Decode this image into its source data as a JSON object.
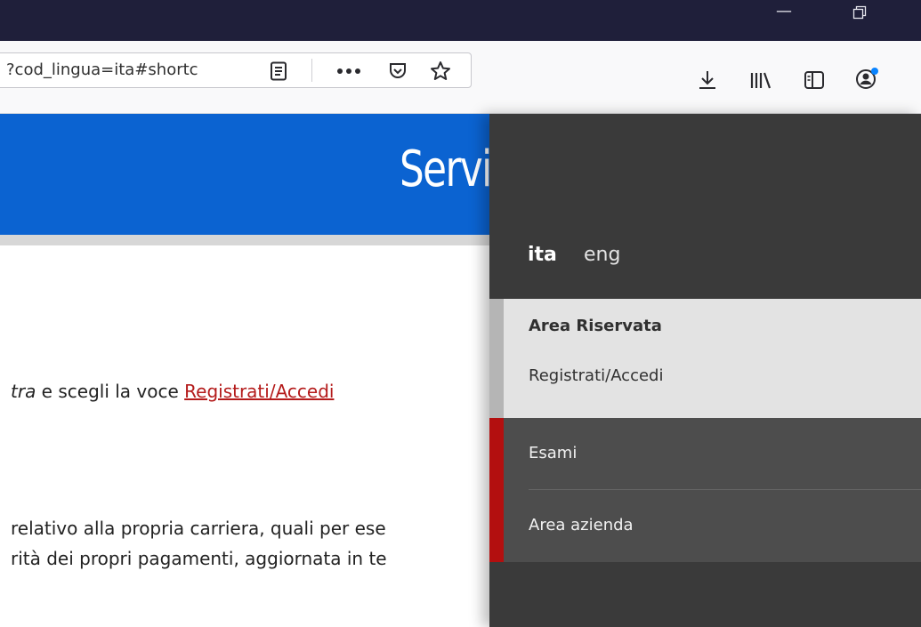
{
  "browser": {
    "url": "?cod_lingua=ita#shortc",
    "icons": {
      "minimize": "minimize-icon",
      "restore": "restore-icon",
      "reader": "reader-view-icon",
      "more": "more-actions-icon",
      "pocket": "pocket-icon",
      "bookmark": "bookmark-star-icon",
      "downloads": "download-icon",
      "library": "library-icon",
      "sidebar": "sidebar-icon",
      "account": "account-icon"
    }
  },
  "page": {
    "banner_title": "Servi",
    "line1_italic": "tra",
    "line1_text": " e scegli la voce ",
    "line1_link": "Registrati/Accedi",
    "line2": "relativo alla propria carriera, quali per ese",
    "line3": "rità dei propri pagamenti, aggiornata in te"
  },
  "menu": {
    "languages": [
      "ita",
      "eng"
    ],
    "reserved_title": "Area Riservata",
    "reserved_link": "Registrati/Accedi",
    "items": [
      "Esami",
      "Area azienda"
    ]
  },
  "colors": {
    "banner": "#0b63d1",
    "link": "#b41b1b",
    "accent_bar": "#b30f0f"
  }
}
